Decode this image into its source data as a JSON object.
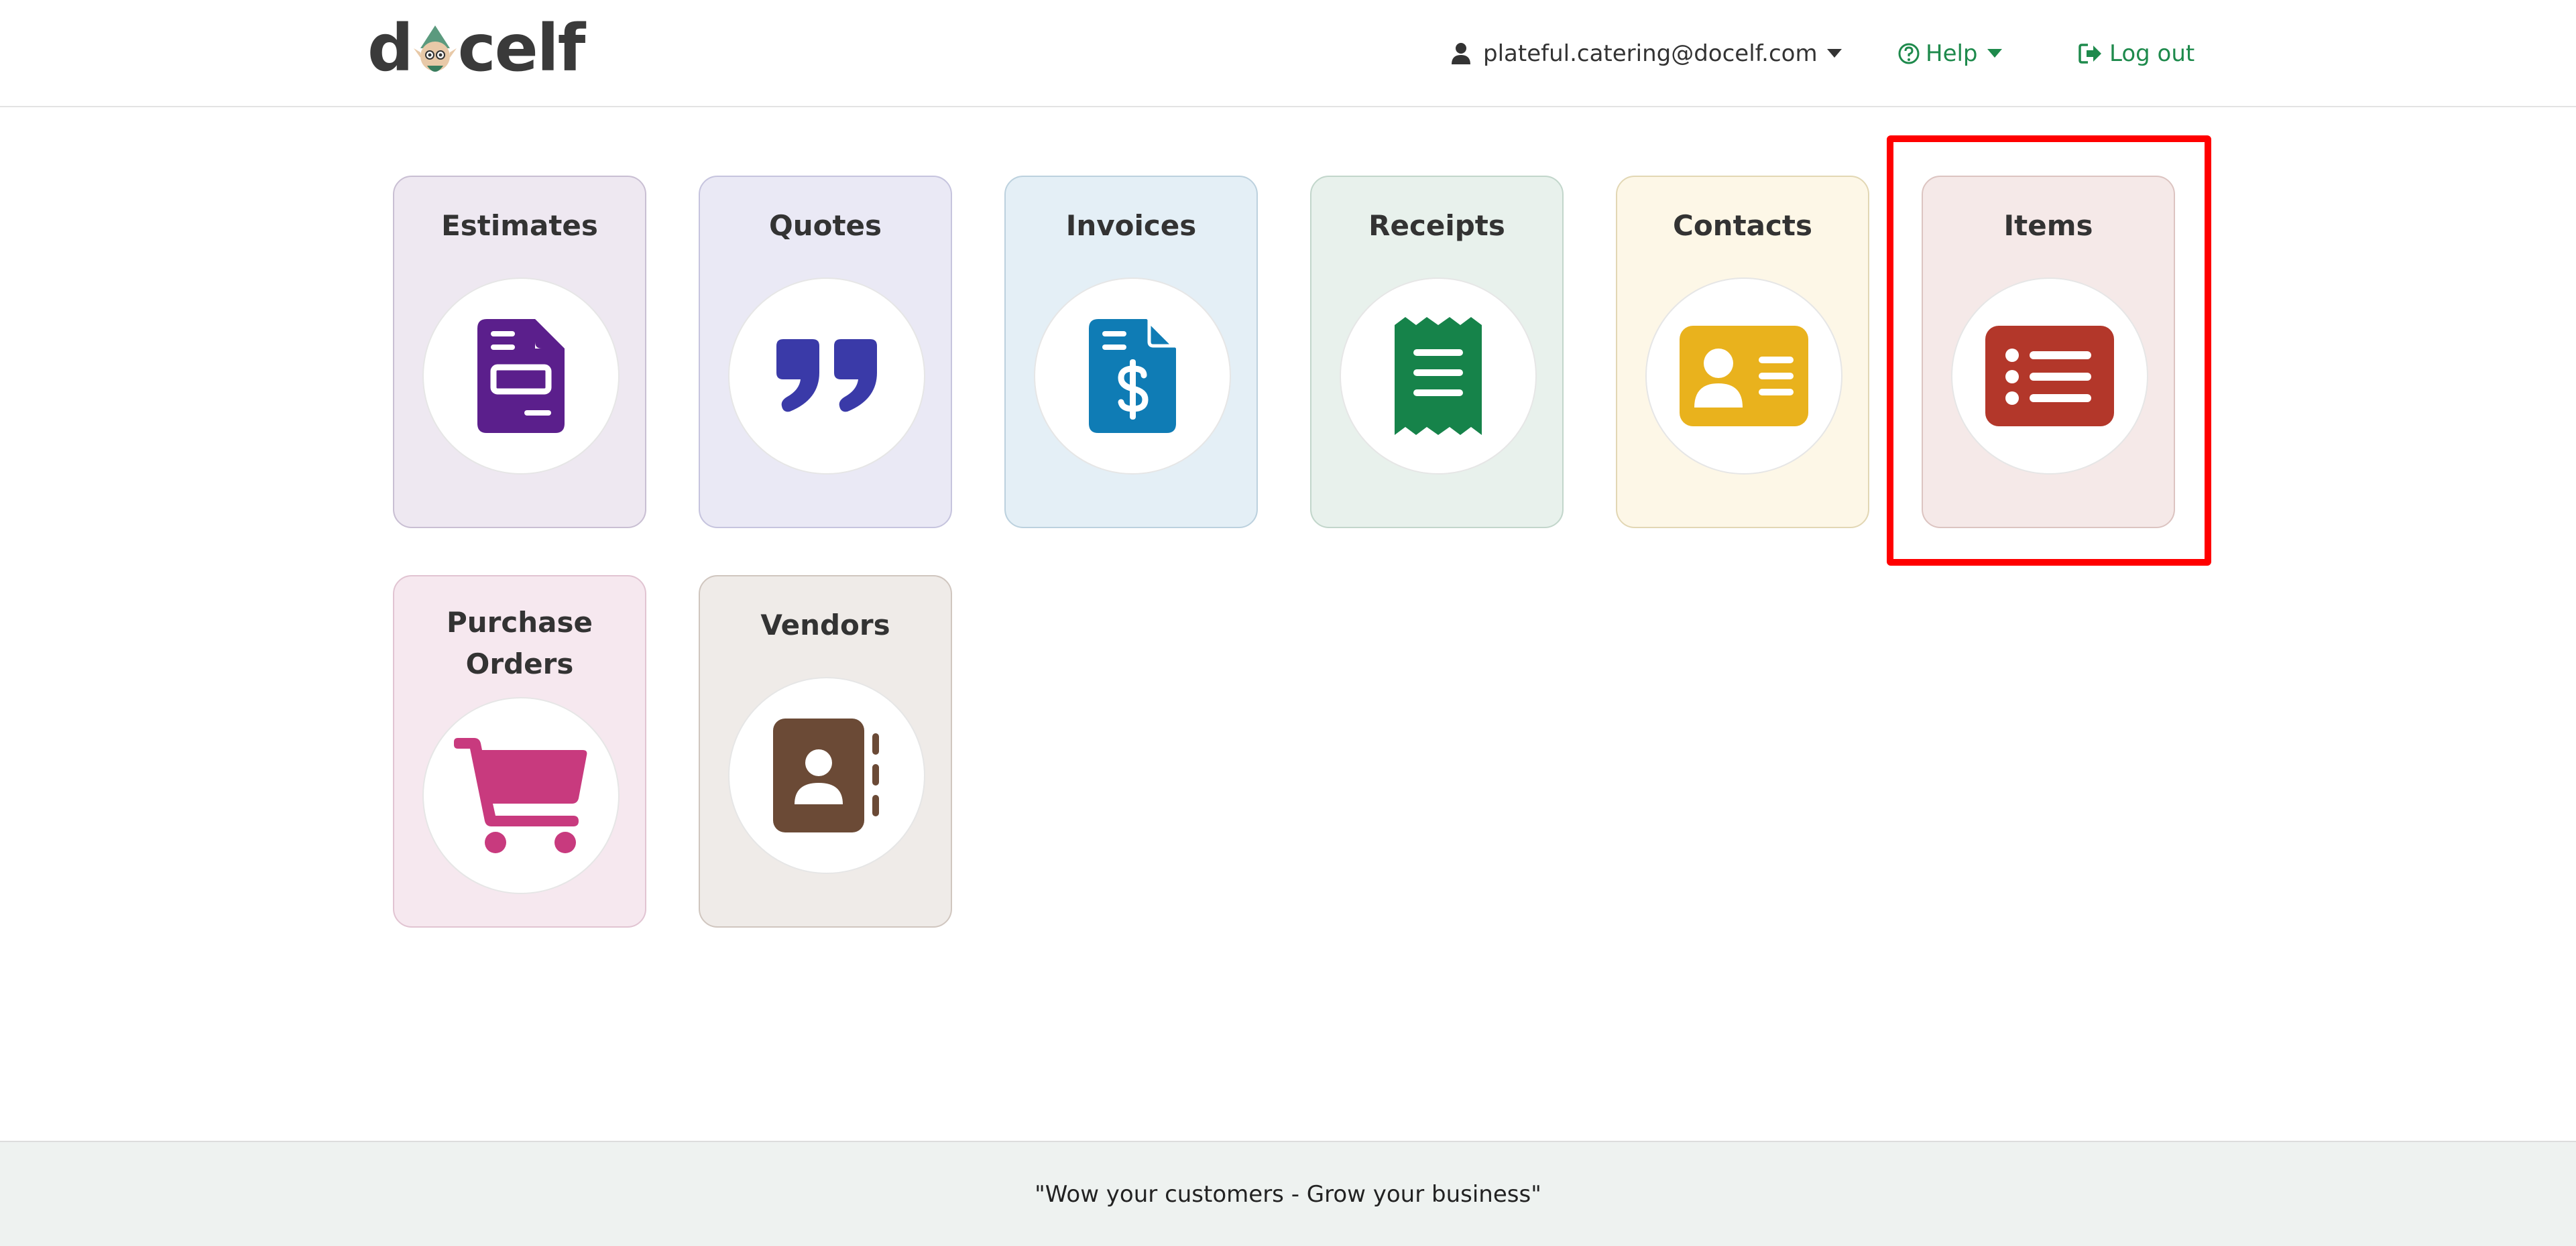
{
  "header": {
    "logo_text": {
      "left": "d",
      "right": "celf"
    },
    "user_email": "plateful.catering@docelf.com",
    "help_label": "Help",
    "logout_label": "Log out"
  },
  "tiles": [
    {
      "label": "Estimates",
      "icon": "estimate-document-icon",
      "bg": "#eee8f1",
      "border": "#c9bfd3",
      "color": "#5b1f8c"
    },
    {
      "label": "Quotes",
      "icon": "quote-marks-icon",
      "bg": "#eae9f5",
      "border": "#c6c4de",
      "color": "#3a3aa8"
    },
    {
      "label": "Invoices",
      "icon": "invoice-dollar-icon",
      "bg": "#e4eff6",
      "border": "#bcd1de",
      "color": "#0f7cb5"
    },
    {
      "label": "Receipts",
      "icon": "receipt-icon",
      "bg": "#e8f1ec",
      "border": "#c2d6cb",
      "color": "#16834a"
    },
    {
      "label": "Contacts",
      "icon": "contact-card-icon",
      "bg": "#fdf7e7",
      "border": "#e2d7b4",
      "color": "#e9b21d"
    },
    {
      "label": "Items",
      "icon": "item-list-icon",
      "bg": "#f5e9e8",
      "border": "#dcc4c1",
      "color": "#b3372a"
    },
    {
      "label": "Purchase Orders",
      "icon": "shopping-cart-icon",
      "bg": "#f6e8ef",
      "border": "#e1c4d2",
      "color": "#c83a7e"
    },
    {
      "label": "Vendors",
      "icon": "address-book-icon",
      "bg": "#efebe8",
      "border": "#d0c6bf",
      "color": "#6b4a36"
    }
  ],
  "footer": {
    "tagline": "\"Wow your customers - Grow your business\""
  }
}
